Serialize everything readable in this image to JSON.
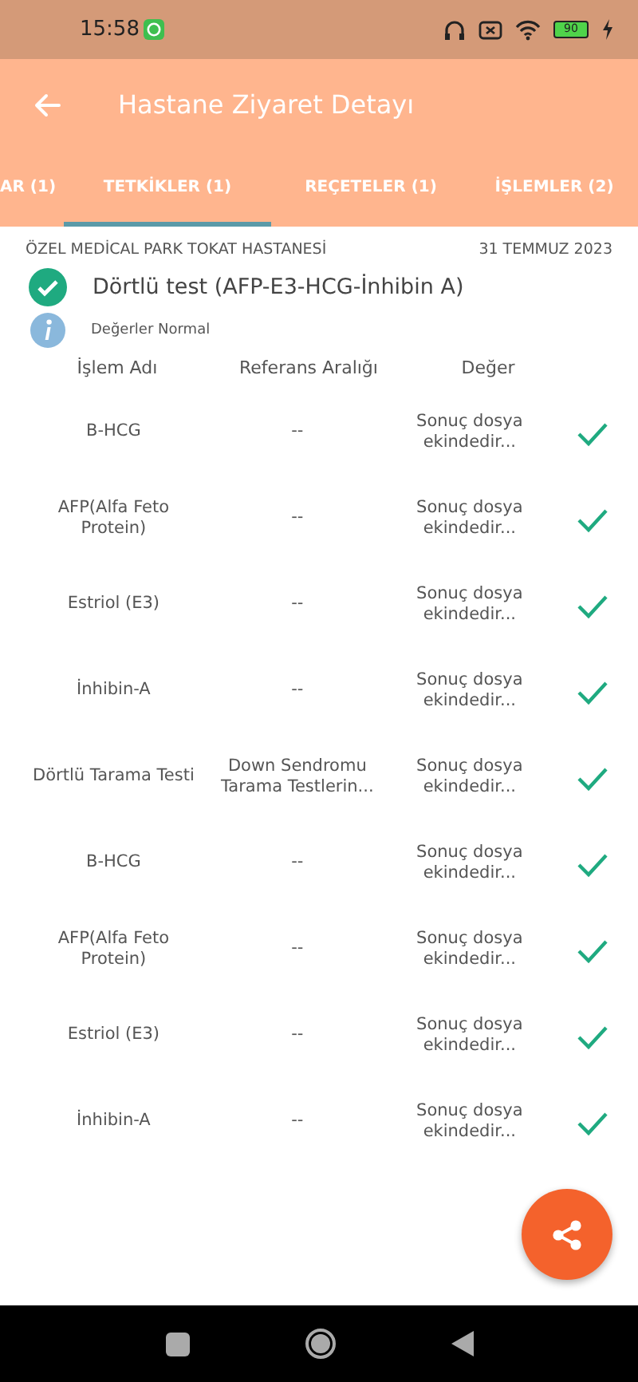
{
  "status_bar": {
    "time": "15:58",
    "battery": "90"
  },
  "app_bar": {
    "title": "Hastane Ziyaret Detayı"
  },
  "tabs": [
    {
      "label": "AR (1)",
      "selected": false
    },
    {
      "label": "TETKİKLER (1)",
      "selected": true
    },
    {
      "label": "REÇETELER (1)",
      "selected": false
    },
    {
      "label": "İŞLEMLER (2)",
      "selected": false
    }
  ],
  "visit": {
    "hospital": "ÖZEL MEDİCAL PARK TOKAT HASTANESİ",
    "date": "31 TEMMUZ 2023",
    "test_name": "Dörtlü test (AFP-E3-HCG-İnhibin A)",
    "note": "Değerler Normal"
  },
  "table": {
    "columns": [
      "İşlem Adı",
      "Referans Aralığı",
      "Değer"
    ],
    "rows": [
      {
        "name": "B-HCG",
        "reference": "--",
        "value": "Sonuç dosya ekindedir...",
        "checked": true
      },
      {
        "name": "AFP(Alfa Feto Protein)",
        "reference": "--",
        "value": "Sonuç dosya ekindedir...",
        "checked": true
      },
      {
        "name": "Estriol (E3)",
        "reference": "--",
        "value": "Sonuç dosya ekindedir...",
        "checked": true
      },
      {
        "name": "İnhibin-A",
        "reference": "--",
        "value": "Sonuç dosya ekindedir...",
        "checked": true
      },
      {
        "name": "Dörtlü Tarama Testi",
        "reference": "Down Sendromu Tarama Testlerin...",
        "value": "Sonuç dosya ekindedir...",
        "checked": true
      },
      {
        "name": "B-HCG",
        "reference": "--",
        "value": "Sonuç dosya ekindedir...",
        "checked": true
      },
      {
        "name": "AFP(Alfa Feto Protein)",
        "reference": "--",
        "value": "Sonuç dosya ekindedir...",
        "checked": true
      },
      {
        "name": "Estriol (E3)",
        "reference": "--",
        "value": "Sonuç dosya ekindedir...",
        "checked": true
      },
      {
        "name": "İnhibin-A",
        "reference": "--",
        "value": "Sonuç dosya ekindedir...",
        "checked": true
      }
    ]
  }
}
